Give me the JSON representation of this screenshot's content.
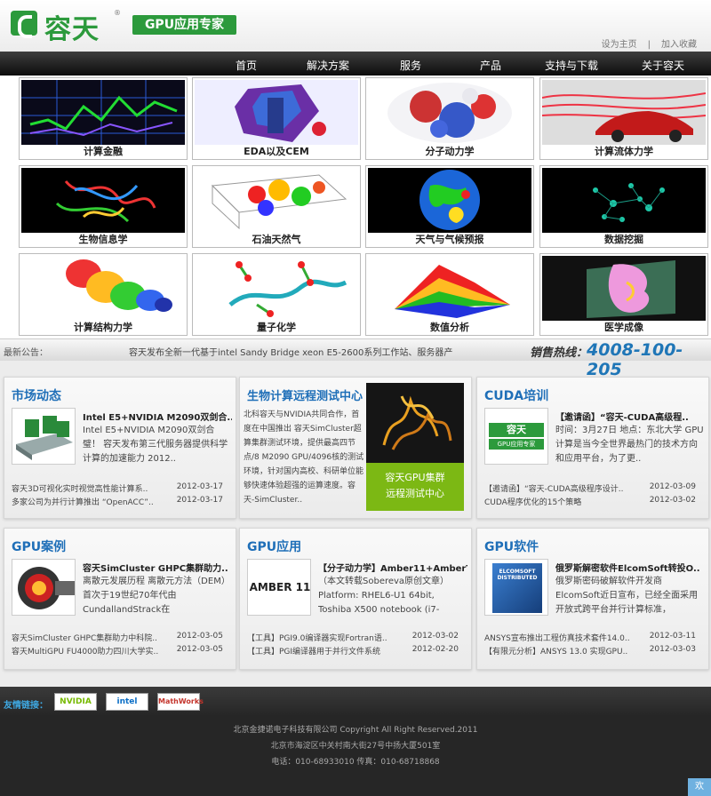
{
  "header": {
    "logo_text": "容天",
    "registered": "®",
    "slogan": "GPU应用专家",
    "set_home": "设为主页",
    "separator": "|",
    "bookmark": "加入收藏"
  },
  "nav": [
    "首页",
    "解决方案",
    "服务",
    "产品",
    "支持与下载",
    "关于容天"
  ],
  "solutions": [
    {
      "label": "计算金融",
      "icon": "finance-graph"
    },
    {
      "label": "EDA以及CEM",
      "icon": "eda-chip"
    },
    {
      "label": "分子动力学",
      "icon": "molecule-surface"
    },
    {
      "label": "计算流体力学",
      "icon": "car-airflow"
    },
    {
      "label": "生物信息学",
      "icon": "protein-ribbon"
    },
    {
      "label": "石油天然气",
      "icon": "seismic-volume"
    },
    {
      "label": "天气与气候预报",
      "icon": "globe-weather"
    },
    {
      "label": "数据挖掘",
      "icon": "data-cloud"
    },
    {
      "label": "计算结构力学",
      "icon": "stress-spiral"
    },
    {
      "label": "量子化学",
      "icon": "quantum-molecule"
    },
    {
      "label": "数值分析",
      "icon": "surface-plot"
    },
    {
      "label": "医学成像",
      "icon": "medical-scan"
    }
  ],
  "notice": {
    "label": "最新公告：",
    "message": "容天发布全新一代基于intel Sandy Bridge xeon E5-2600系列工作站、服务器产",
    "hotline_label": "销售热线：",
    "hotline": "4008-100-205"
  },
  "panels": {
    "market": {
      "title": "市场动态",
      "feature_title": "Intel E5+NVIDIA M2090双剑合..",
      "feature_desc": "Intel E5+NVIDIA M2090双剑合璧！ 容天发布第三代服务器提供科学计算的加速能力 2012..",
      "items": [
        {
          "text": "容天3D可视化实时视觉高性能计算系..",
          "date": "2012-03-17"
        },
        {
          "text": "多家公司为并行计算推出 “OpenACC”..",
          "date": "2012-03-17"
        }
      ]
    },
    "bio": {
      "title": "生物计算远程测试中心",
      "desc": "北科容天与NVIDIA共同合作，首度在中国推出 容天SimCluster超算集群测试环境，提供最高四节点/8 M2090 GPU/4096核的测试环境，针对国内高校、科研单位能够快速体验超强的运算速度。容天-SimCluster..",
      "box_line1": "容天GPU集群",
      "box_line2": "远程测试中心"
    },
    "cuda": {
      "title": "CUDA培训",
      "thumb_logo": "容天",
      "thumb_slogan": "GPU应用专家",
      "feature_title": "【邀请函】“容天-CUDA高级程..",
      "feature_desc": "时间：3月27日 地点：东北大学 GPU计算是当今全世界最热门的技术方向和应用平台，为了更..",
      "items": [
        {
          "text": "【邀请函】“容天-CUDA高级程序设计..",
          "date": "2012-03-09"
        },
        {
          "text": "CUDA程序优化的15个策略",
          "date": "2012-03-02"
        }
      ]
    },
    "gpu_case": {
      "title": "GPU案例",
      "feature_title": "容天SimCluster GHPC集群助力..",
      "feature_desc": "离散元发展历程 离散元方法（DEM）首次于19世纪70年代由CundallandStrack在《Adiscretenu..",
      "items": [
        {
          "text": "容天SimCluster GHPC集群助力中科院..",
          "date": "2012-03-05"
        },
        {
          "text": "容天MultiGPU FU4000助力四川大学实..",
          "date": "2012-03-05"
        }
      ]
    },
    "gpu_app": {
      "title": "GPU应用",
      "thumb_text": "AMBER 11",
      "feature_title": "【分子动力学】Amber11+AmberT..",
      "feature_desc": "（本文转载Sobereva原创文章） Platform: RHEL6-U1 64bit, Toshiba X500 notebook (i7-2630Q..",
      "items": [
        {
          "text": "【工具】PGI9.0编译器实现Fortran语..",
          "date": "2012-03-02"
        },
        {
          "text": "【工具】PGI编译器用于并行文件系统",
          "date": "2012-02-20"
        }
      ]
    },
    "gpu_soft": {
      "title": "GPU软件",
      "thumb_text": "ELCOMSOFT DISTRIBUTED",
      "feature_title": "俄罗斯解密软件ElcomSoft转投O..",
      "feature_desc": "俄罗斯密码破解软件开发商ElcomSoft近日宣布，已经全面采用开放式跨平台并行计算标准，OpenCL..",
      "items": [
        {
          "text": "ANSYS宣布推出工程仿真技术套件14.0..",
          "date": "2012-03-11"
        },
        {
          "text": "【有限元分析】ANSYS 13.0 实现GPU..",
          "date": "2012-03-03"
        }
      ]
    }
  },
  "links": {
    "label": "友情链接：",
    "partners": [
      "NVIDIA",
      "intel",
      "MathWorks"
    ]
  },
  "footer": {
    "copyright": "北京金捷诺电子科技有限公司 Copyright All Right Reserved.2011",
    "address": "北京市海淀区中关村南大街27号中扬大厦501室",
    "contact": "电话：010-68933010 传真：010-68718868"
  },
  "welcome": "欢迎"
}
